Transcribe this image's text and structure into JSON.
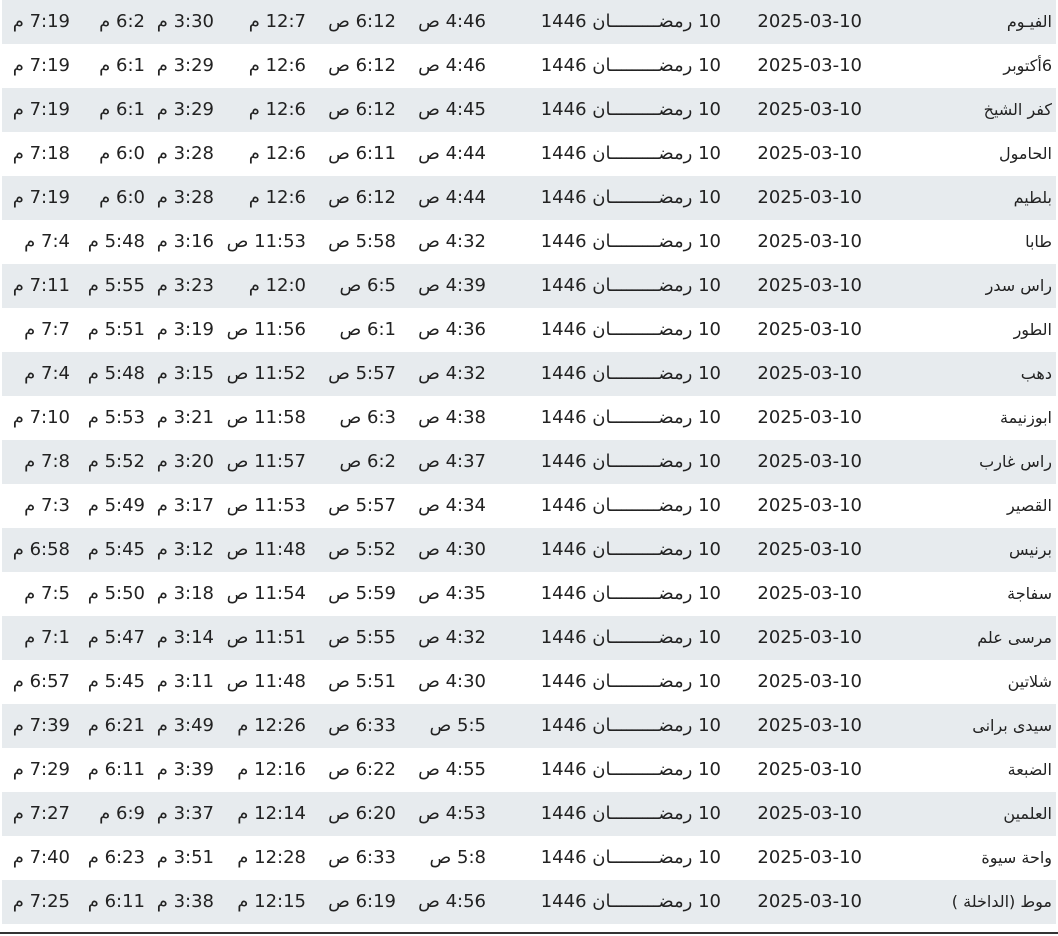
{
  "rows": [
    {
      "city": "الفيـوم",
      "date": "2025-03-10",
      "hijri": "10 رمضـــــــــان 1446",
      "fajr": "4:46 ص",
      "sunrise": "6:12 ص",
      "dhuhr": "12:7 م",
      "asr": "3:30 م",
      "maghrib": "6:2 م",
      "isha": "7:19 م"
    },
    {
      "city": "6أكتوبر",
      "date": "2025-03-10",
      "hijri": "10 رمضـــــــــان 1446",
      "fajr": "4:46 ص",
      "sunrise": "6:12 ص",
      "dhuhr": "12:6 م",
      "asr": "3:29 م",
      "maghrib": "6:1 م",
      "isha": "7:19 م"
    },
    {
      "city": "كفر الشيخ",
      "date": "2025-03-10",
      "hijri": "10 رمضـــــــــان 1446",
      "fajr": "4:45 ص",
      "sunrise": "6:12 ص",
      "dhuhr": "12:6 م",
      "asr": "3:29 م",
      "maghrib": "6:1 م",
      "isha": "7:19 م"
    },
    {
      "city": "الحامول",
      "date": "2025-03-10",
      "hijri": "10 رمضـــــــــان 1446",
      "fajr": "4:44 ص",
      "sunrise": "6:11 ص",
      "dhuhr": "12:6 م",
      "asr": "3:28 م",
      "maghrib": "6:0 م",
      "isha": "7:18 م"
    },
    {
      "city": "بلطيم",
      "date": "2025-03-10",
      "hijri": "10 رمضـــــــــان 1446",
      "fajr": "4:44 ص",
      "sunrise": "6:12 ص",
      "dhuhr": "12:6 م",
      "asr": "3:28 م",
      "maghrib": "6:0 م",
      "isha": "7:19 م"
    },
    {
      "city": "طابا",
      "date": "2025-03-10",
      "hijri": "10 رمضـــــــــان 1446",
      "fajr": "4:32 ص",
      "sunrise": "5:58 ص",
      "dhuhr": "11:53 ص",
      "asr": "3:16 م",
      "maghrib": "5:48 م",
      "isha": "7:4 م"
    },
    {
      "city": "راس سدر",
      "date": "2025-03-10",
      "hijri": "10 رمضـــــــــان 1446",
      "fajr": "4:39 ص",
      "sunrise": "6:5 ص",
      "dhuhr": "12:0 م",
      "asr": "3:23 م",
      "maghrib": "5:55 م",
      "isha": "7:11 م"
    },
    {
      "city": "الطور",
      "date": "2025-03-10",
      "hijri": "10 رمضـــــــــان 1446",
      "fajr": "4:36 ص",
      "sunrise": "6:1 ص",
      "dhuhr": "11:56 ص",
      "asr": "3:19 م",
      "maghrib": "5:51 م",
      "isha": "7:7 م"
    },
    {
      "city": "دهب",
      "date": "2025-03-10",
      "hijri": "10 رمضـــــــــان 1446",
      "fajr": "4:32 ص",
      "sunrise": "5:57 ص",
      "dhuhr": "11:52 ص",
      "asr": "3:15 م",
      "maghrib": "5:48 م",
      "isha": "7:4 م"
    },
    {
      "city": "ابوزنيمة",
      "date": "2025-03-10",
      "hijri": "10 رمضـــــــــان 1446",
      "fajr": "4:38 ص",
      "sunrise": "6:3 ص",
      "dhuhr": "11:58 ص",
      "asr": "3:21 م",
      "maghrib": "5:53 م",
      "isha": "7:10 م"
    },
    {
      "city": "راس غارب",
      "date": "2025-03-10",
      "hijri": "10 رمضـــــــــان 1446",
      "fajr": "4:37 ص",
      "sunrise": "6:2 ص",
      "dhuhr": "11:57 ص",
      "asr": "3:20 م",
      "maghrib": "5:52 م",
      "isha": "7:8 م"
    },
    {
      "city": "القصير",
      "date": "2025-03-10",
      "hijri": "10 رمضـــــــــان 1446",
      "fajr": "4:34 ص",
      "sunrise": "5:57 ص",
      "dhuhr": "11:53 ص",
      "asr": "3:17 م",
      "maghrib": "5:49 م",
      "isha": "7:3 م"
    },
    {
      "city": "برنيس",
      "date": "2025-03-10",
      "hijri": "10 رمضـــــــــان 1446",
      "fajr": "4:30 ص",
      "sunrise": "5:52 ص",
      "dhuhr": "11:48 ص",
      "asr": "3:12 م",
      "maghrib": "5:45 م",
      "isha": "6:58 م"
    },
    {
      "city": "سفاجة",
      "date": "2025-03-10",
      "hijri": "10 رمضـــــــــان 1446",
      "fajr": "4:35 ص",
      "sunrise": "5:59 ص",
      "dhuhr": "11:54 ص",
      "asr": "3:18 م",
      "maghrib": "5:50 م",
      "isha": "7:5 م"
    },
    {
      "city": "مرسى علم",
      "date": "2025-03-10",
      "hijri": "10 رمضـــــــــان 1446",
      "fajr": "4:32 ص",
      "sunrise": "5:55 ص",
      "dhuhr": "11:51 ص",
      "asr": "3:14 م",
      "maghrib": "5:47 م",
      "isha": "7:1 م"
    },
    {
      "city": "شلاتين",
      "date": "2025-03-10",
      "hijri": "10 رمضـــــــــان 1446",
      "fajr": "4:30 ص",
      "sunrise": "5:51 ص",
      "dhuhr": "11:48 ص",
      "asr": "3:11 م",
      "maghrib": "5:45 م",
      "isha": "6:57 م"
    },
    {
      "city": "سيدى برانى",
      "date": "2025-03-10",
      "hijri": "10 رمضـــــــــان 1446",
      "fajr": "5:5 ص",
      "sunrise": "6:33 ص",
      "dhuhr": "12:26 م",
      "asr": "3:49 م",
      "maghrib": "6:21 م",
      "isha": "7:39 م"
    },
    {
      "city": "الضبعة",
      "date": "2025-03-10",
      "hijri": "10 رمضـــــــــان 1446",
      "fajr": "4:55 ص",
      "sunrise": "6:22 ص",
      "dhuhr": "12:16 م",
      "asr": "3:39 م",
      "maghrib": "6:11 م",
      "isha": "7:29 م"
    },
    {
      "city": "العلمين",
      "date": "2025-03-10",
      "hijri": "10 رمضـــــــــان 1446",
      "fajr": "4:53 ص",
      "sunrise": "6:20 ص",
      "dhuhr": "12:14 م",
      "asr": "3:37 م",
      "maghrib": "6:9 م",
      "isha": "7:27 م"
    },
    {
      "city": "واحة سيوة",
      "date": "2025-03-10",
      "hijri": "10 رمضـــــــــان 1446",
      "fajr": "5:8 ص",
      "sunrise": "6:33 ص",
      "dhuhr": "12:28 م",
      "asr": "3:51 م",
      "maghrib": "6:23 م",
      "isha": "7:40 م"
    },
    {
      "city": "موط (الداخلة )",
      "date": "2025-03-10",
      "hijri": "10 رمضـــــــــان 1446",
      "fajr": "4:56 ص",
      "sunrise": "6:19 ص",
      "dhuhr": "12:15 م",
      "asr": "3:38 م",
      "maghrib": "6:11 م",
      "isha": "7:25 م"
    }
  ],
  "colors": {
    "shaded_row": "#e7ebee",
    "text": "#222222",
    "rule": "#333333"
  }
}
